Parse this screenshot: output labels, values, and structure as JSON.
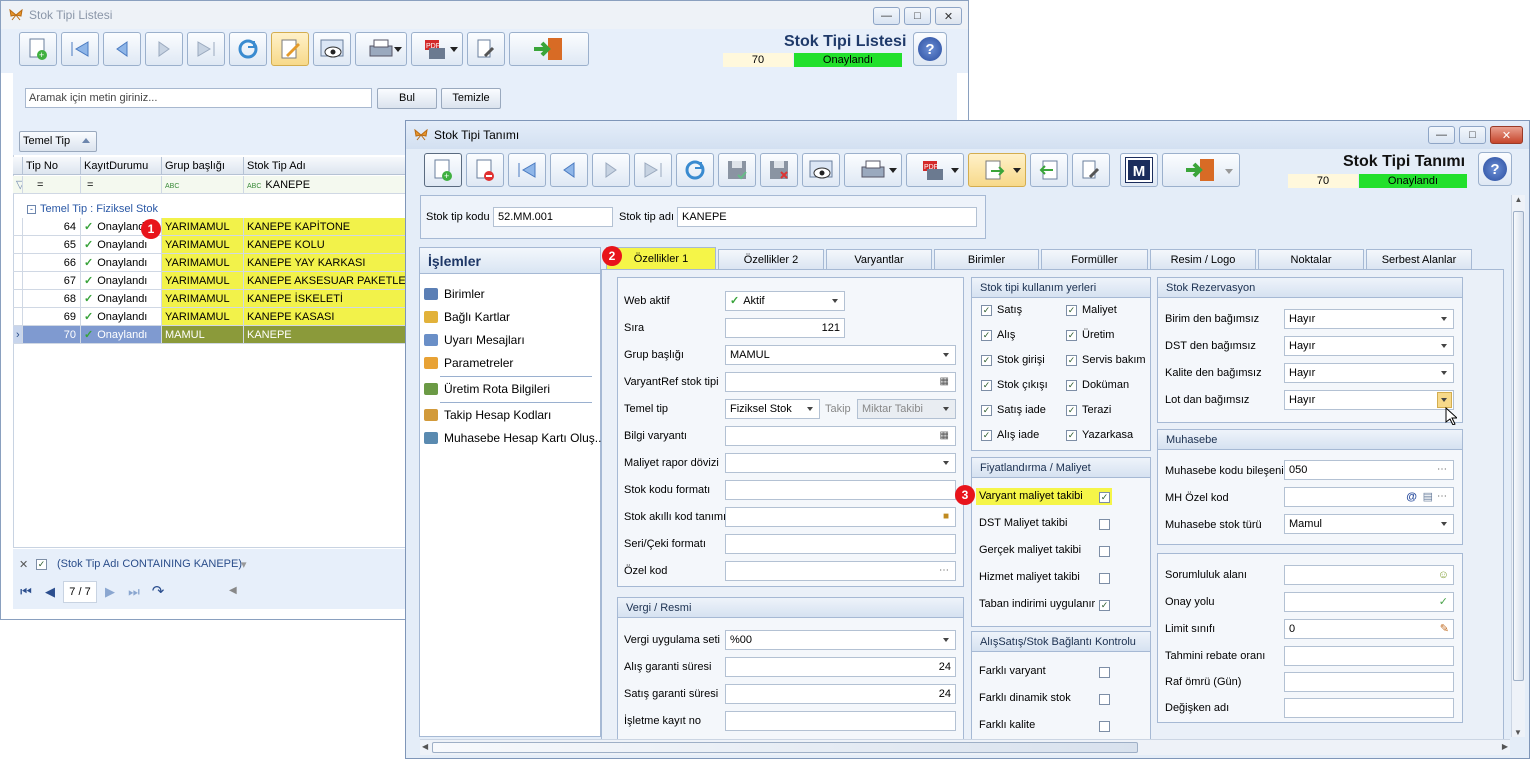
{
  "list_window": {
    "title": "Stok Tipi Listesi",
    "header_title": "Stok Tipi Listesi",
    "record_no": "70",
    "status": "Onaylandı",
    "search_placeholder": "Aramak için metin giriniz...",
    "find_label": "Bul",
    "clear_label": "Temizle",
    "group_panel": "Temel Tip",
    "columns": [
      "Tip No",
      "KayıtDurumu",
      "Grup başlığı",
      "Stok Tip Adı"
    ],
    "filter_row": {
      "c1": "=",
      "c2": "=",
      "c3": "",
      "c4": "KANEPE"
    },
    "group_row": "Temel Tip : Fiziksel Stok",
    "rows": [
      {
        "no": "64",
        "status": "Onaylandı",
        "group": "YARIMAMUL",
        "name": "KANEPE KAPİTONE"
      },
      {
        "no": "65",
        "status": "Onaylandı",
        "group": "YARIMAMUL",
        "name": "KANEPE KOLU"
      },
      {
        "no": "66",
        "status": "Onaylandı",
        "group": "YARIMAMUL",
        "name": "KANEPE YAY KARKASI"
      },
      {
        "no": "67",
        "status": "Onaylandı",
        "group": "YARIMAMUL",
        "name": "KANEPE AKSESUAR PAKETLEME"
      },
      {
        "no": "68",
        "status": "Onaylandı",
        "group": "YARIMAMUL",
        "name": "KANEPE İSKELETİ"
      },
      {
        "no": "69",
        "status": "Onaylandı",
        "group": "YARIMAMUL",
        "name": "KANEPE KASASI"
      },
      {
        "no": "70",
        "status": "Onaylandı",
        "group": "MAMUL",
        "name": "KANEPE"
      }
    ],
    "filter_text": "(Stok Tip Adı CONTAINING KANEPE)",
    "pager": "7 / 7"
  },
  "def_window": {
    "title": "Stok Tipi Tanımı",
    "header_title": "Stok Tipi Tanımı",
    "record_no": "70",
    "status": "Onaylandı",
    "stok_tip_kodu_label": "Stok tip kodu",
    "stok_tip_kodu": "52.MM.001",
    "stok_tip_adi_label": "Stok tip adı",
    "stok_tip_adi": "KANEPE",
    "ops_title": "İşlemler",
    "ops": [
      "Birimler",
      "Bağlı Kartlar",
      "Uyarı Mesajları",
      "Parametreler",
      "Üretim Rota Bilgileri",
      "Takip Hesap Kodları",
      "Muhasebe Hesap Kartı Oluş..."
    ],
    "tabs": [
      "Özellikler 1",
      "Özellikler 2",
      "Varyantlar",
      "Birimler",
      "Formüller",
      "Resim / Logo",
      "Noktalar",
      "Serbest Alanlar"
    ],
    "markers": [
      "1",
      "2",
      "3"
    ],
    "fields": {
      "web_aktif_l": "Web aktif",
      "web_aktif": "Aktif",
      "sira_l": "Sıra",
      "sira": "121",
      "grup_l": "Grup başlığı",
      "grup": "MAMUL",
      "varref_l": "VaryantRef stok tipi",
      "temel_l": "Temel tip",
      "temel": "Fiziksel Stok",
      "takip_l": "Takip",
      "takip": "Miktar Takibi",
      "bilgi_l": "Bilgi varyantı",
      "maliyet_l": "Maliyet rapor dövizi",
      "kod_format_l": "Stok kodu formatı",
      "akilli_l": "Stok akıllı kod tanımı",
      "seri_l": "Seri/Çeki formatı",
      "ozel_l": "Özel kod"
    },
    "vergi": {
      "title": "Vergi / Resmi",
      "vus_l": "Vergi uygulama seti",
      "vus": "%00",
      "alis_l": "Alış garanti süresi",
      "alis": "24",
      "satis_l": "Satış garanti süresi",
      "satis": "24",
      "isletme_l": "İşletme kayıt no"
    },
    "kullanim": {
      "title": "Stok tipi kullanım yerleri",
      "left": [
        "Satış",
        "Alış",
        "Stok girişi",
        "Stok çıkışı",
        "Satış iade",
        "Alış iade"
      ],
      "right": [
        "Maliyet",
        "Üretim",
        "Servis bakım",
        "Doküman",
        "Terazi",
        "Yazarkasa"
      ]
    },
    "fiyat": {
      "title": "Fiyatlandırma / Maliyet",
      "items": [
        "Varyant maliyet takibi",
        "DST Maliyet takibi",
        "Gerçek maliyet takibi",
        "Hizmet maliyet takibi",
        "Taban indirimi uygulanır"
      ]
    },
    "alsat": {
      "title": "AlışSatış/Stok Bağlantı Kontrolu",
      "items": [
        "Farklı varyant",
        "Farklı dinamik stok",
        "Farklı kalite"
      ]
    },
    "rezerv": {
      "title": "Stok Rezervasyon",
      "items": [
        {
          "label": "Birim den bağımsız",
          "value": "Hayır"
        },
        {
          "label": "DST den bağımsız",
          "value": "Hayır"
        },
        {
          "label": "Kalite den bağımsız",
          "value": "Hayır"
        },
        {
          "label": "Lot dan bağımsız",
          "value": "Hayır"
        }
      ]
    },
    "muhasebe": {
      "title": "Muhasebe",
      "kod_l": "Muhasebe kodu bileşeni",
      "kod": "050",
      "mh_l": "MH Özel kod",
      "tur_l": "Muhasebe stok türü",
      "tur": "Mamul"
    },
    "diger": {
      "sor_l": "Sorumluluk alanı",
      "onay_l": "Onay yolu",
      "limit_l": "Limit sınıfı",
      "limit": "0",
      "rebate_l": "Tahmini rebate oranı",
      "raf_l": "Raf ömrü (Gün)",
      "deg_l": "Değişken adı"
    }
  }
}
